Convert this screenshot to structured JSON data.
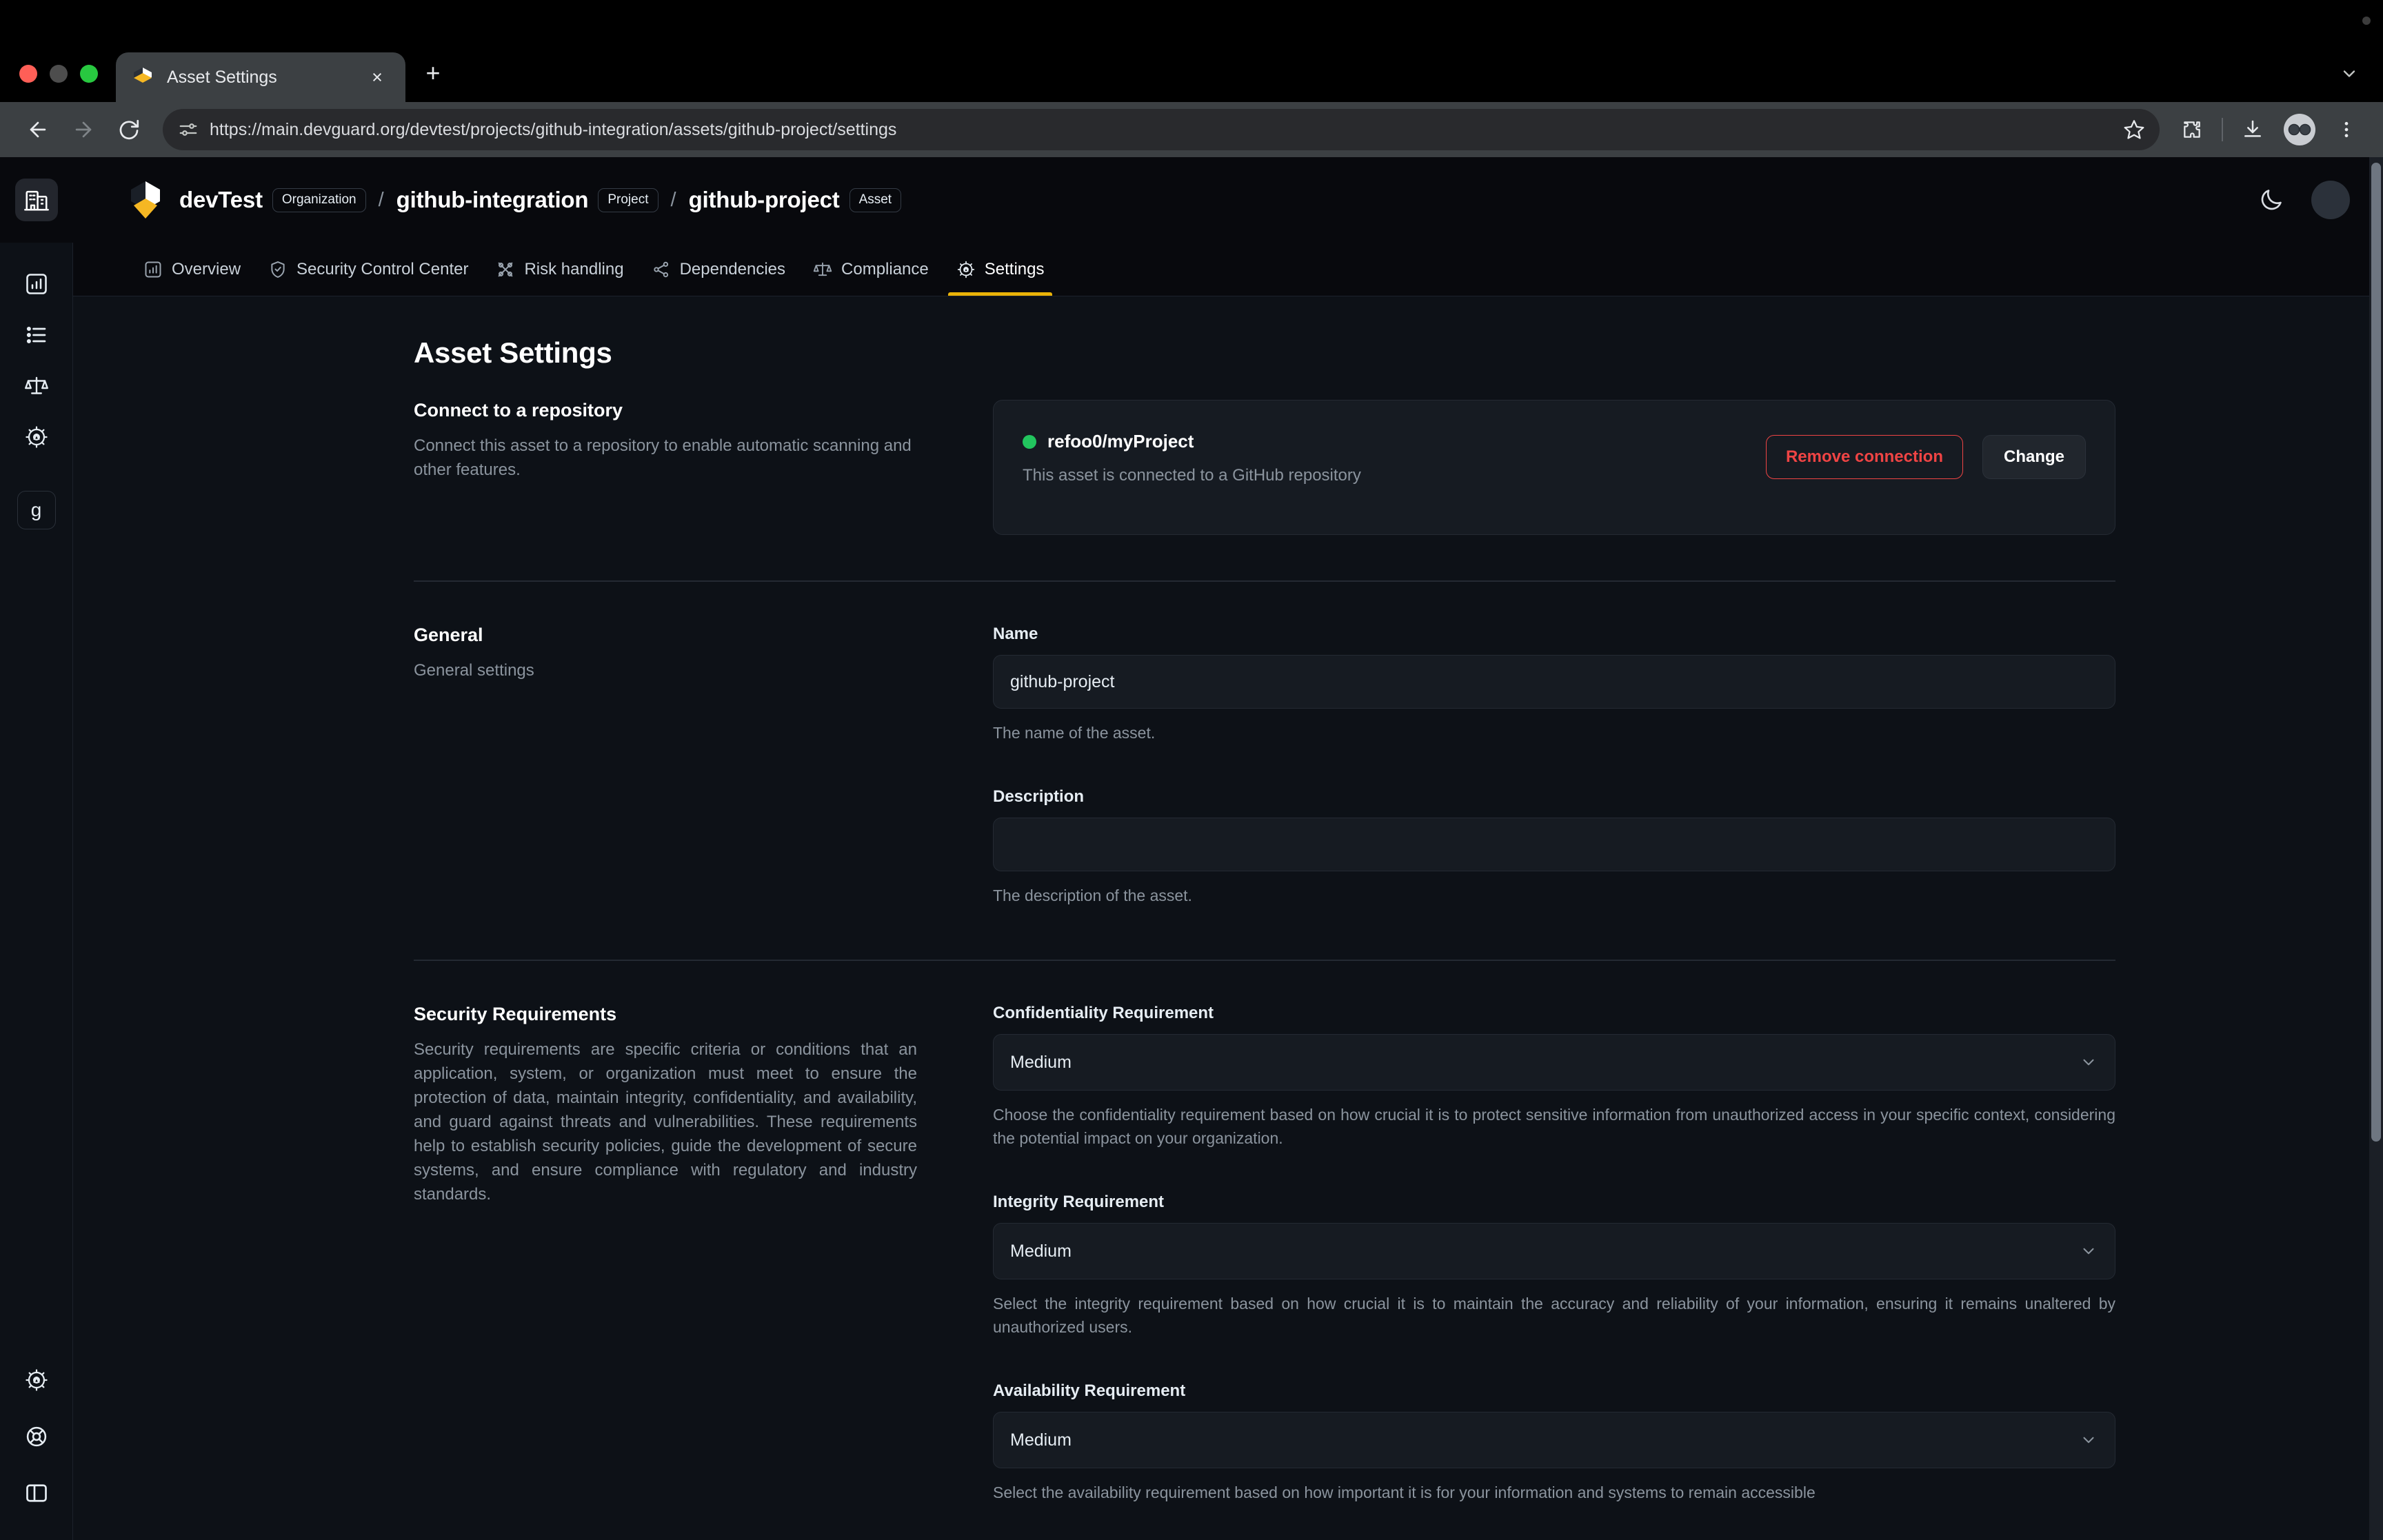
{
  "browser": {
    "tab": {
      "title": "Asset Settings",
      "favicon": "devguard-cube-icon",
      "close": "×"
    },
    "new_tab_label": "+",
    "tabstrip_chevron": "chevron-down-icon",
    "nav": {
      "back": "←",
      "forward": "→",
      "reload": "⟳"
    },
    "url": "https://main.devguard.org/devtest/projects/github-integration/assets/github-project/settings",
    "toolbar_icons": [
      "bookmark-star-icon",
      "extensions-puzzle-icon",
      "downloads-icon",
      "profile-avatar",
      "chrome-menu-icon"
    ]
  },
  "rail": {
    "org_icon": "organization-building-icon",
    "items": [
      {
        "icon": "chart-bar-icon",
        "name": "overview"
      },
      {
        "icon": "list-icon",
        "name": "list"
      },
      {
        "icon": "scales-icon",
        "name": "compliance"
      },
      {
        "icon": "gear-icon",
        "name": "settings"
      }
    ],
    "badge": "g",
    "bottom": [
      {
        "icon": "gear-icon",
        "name": "settings"
      },
      {
        "icon": "lifebuoy-icon",
        "name": "help"
      },
      {
        "icon": "panel-toggle-icon",
        "name": "sidebar-toggle"
      }
    ]
  },
  "header": {
    "logo": "devguard-logo",
    "breadcrumb": [
      {
        "name": "devTest",
        "tag": "Organization"
      },
      {
        "name": "github-integration",
        "tag": "Project"
      },
      {
        "name": "github-project",
        "tag": "Asset"
      }
    ],
    "separator": "/",
    "theme_toggle": "moon-icon",
    "avatar": "user-avatar"
  },
  "nav_tabs": [
    {
      "label": "Overview",
      "icon": "chart-bar-icon",
      "active": false
    },
    {
      "label": "Security Control Center",
      "icon": "shield-check-icon",
      "active": false
    },
    {
      "label": "Risk handling",
      "icon": "risk-icon",
      "active": false
    },
    {
      "label": "Dependencies",
      "icon": "share-nodes-icon",
      "active": false
    },
    {
      "label": "Compliance",
      "icon": "scales-icon",
      "active": false
    },
    {
      "label": "Settings",
      "icon": "gear-icon",
      "active": true
    }
  ],
  "page": {
    "title": "Asset Settings",
    "repo_section": {
      "title": "Connect to a repository",
      "description": "Connect this asset to a repository to enable automatic scanning and other features.",
      "card": {
        "status_color": "#22c55e",
        "repo_name": "refoo0/myProject",
        "subtitle": "This asset is connected to a GitHub repository",
        "remove_label": "Remove connection",
        "change_label": "Change"
      }
    },
    "general_section": {
      "title": "General",
      "description": "General settings",
      "name_field": {
        "label": "Name",
        "value": "github-project",
        "placeholder": "",
        "help": "The name of the asset."
      },
      "description_field": {
        "label": "Description",
        "value": "",
        "placeholder": "",
        "help": "The description of the asset."
      }
    },
    "security_section": {
      "title": "Security Requirements",
      "description": "Security requirements are specific criteria or conditions that an application, system, or organization must meet to ensure the protection of data, maintain integrity, confidentiality, and availability, and guard against threats and vulnerabilities. These requirements help to establish security policies, guide the development of secure systems, and ensure compliance with regulatory and industry standards.",
      "fields": [
        {
          "label": "Confidentiality Requirement",
          "value": "Medium",
          "help": "Choose the confidentiality requirement based on how crucial it is to protect sensitive information from unauthorized access in your specific context, considering the potential impact on your organization."
        },
        {
          "label": "Integrity Requirement",
          "value": "Medium",
          "help": "Select the integrity requirement based on how crucial it is to maintain the accuracy and reliability of your information, ensuring it remains unaltered by unauthorized users."
        },
        {
          "label": "Availability Requirement",
          "value": "Medium",
          "help": "Select the availability requirement based on how important it is for your information and systems to remain accessible"
        }
      ]
    }
  },
  "colors": {
    "accent": "#eab308",
    "danger": "#ef4444",
    "success": "#22c55e",
    "background": "#0d1117",
    "surface": "#161b22"
  }
}
